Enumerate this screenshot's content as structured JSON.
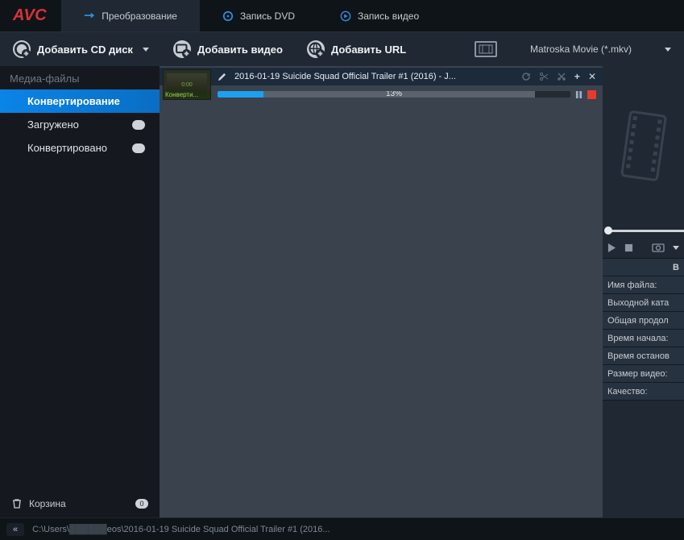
{
  "logo": "AVC",
  "tabs": [
    {
      "label": "Преобразование",
      "active": true
    },
    {
      "label": "Запись DVD",
      "active": false
    },
    {
      "label": "Запись видео",
      "active": false
    }
  ],
  "toolbar": {
    "add_cd": "Добавить CD диск",
    "add_video": "Добавить видео",
    "add_url": "Добавить URL",
    "format": "Matroska Movie (*.mkv)"
  },
  "sidebar": {
    "header": "Медиа-файлы",
    "items": [
      {
        "label": "Конвертирование",
        "active": true,
        "badge": ""
      },
      {
        "label": "Загружено",
        "active": false,
        "badge": ""
      },
      {
        "label": "Конвертировано",
        "active": false,
        "badge": ""
      }
    ],
    "trash": {
      "label": "Корзина",
      "count": "0"
    }
  },
  "file": {
    "title": "2016-01-19 Suicide Squad Official Trailer #1 (2016) - J...",
    "thumb_time": "0:00",
    "thumb_label": "Конверти...",
    "progress_pct": 13,
    "progress_label": "13%"
  },
  "info": {
    "header": "В",
    "rows": [
      "Имя файла:",
      "Выходной ката",
      "Общая продол",
      "Время начала:",
      "Время останов",
      "Размер видео:",
      "Качество:"
    ]
  },
  "status": {
    "path_pre": "C:\\Users\\",
    "path_post": "eos\\2016-01-19 Suicide Squad Official Trailer #1 (2016..."
  }
}
